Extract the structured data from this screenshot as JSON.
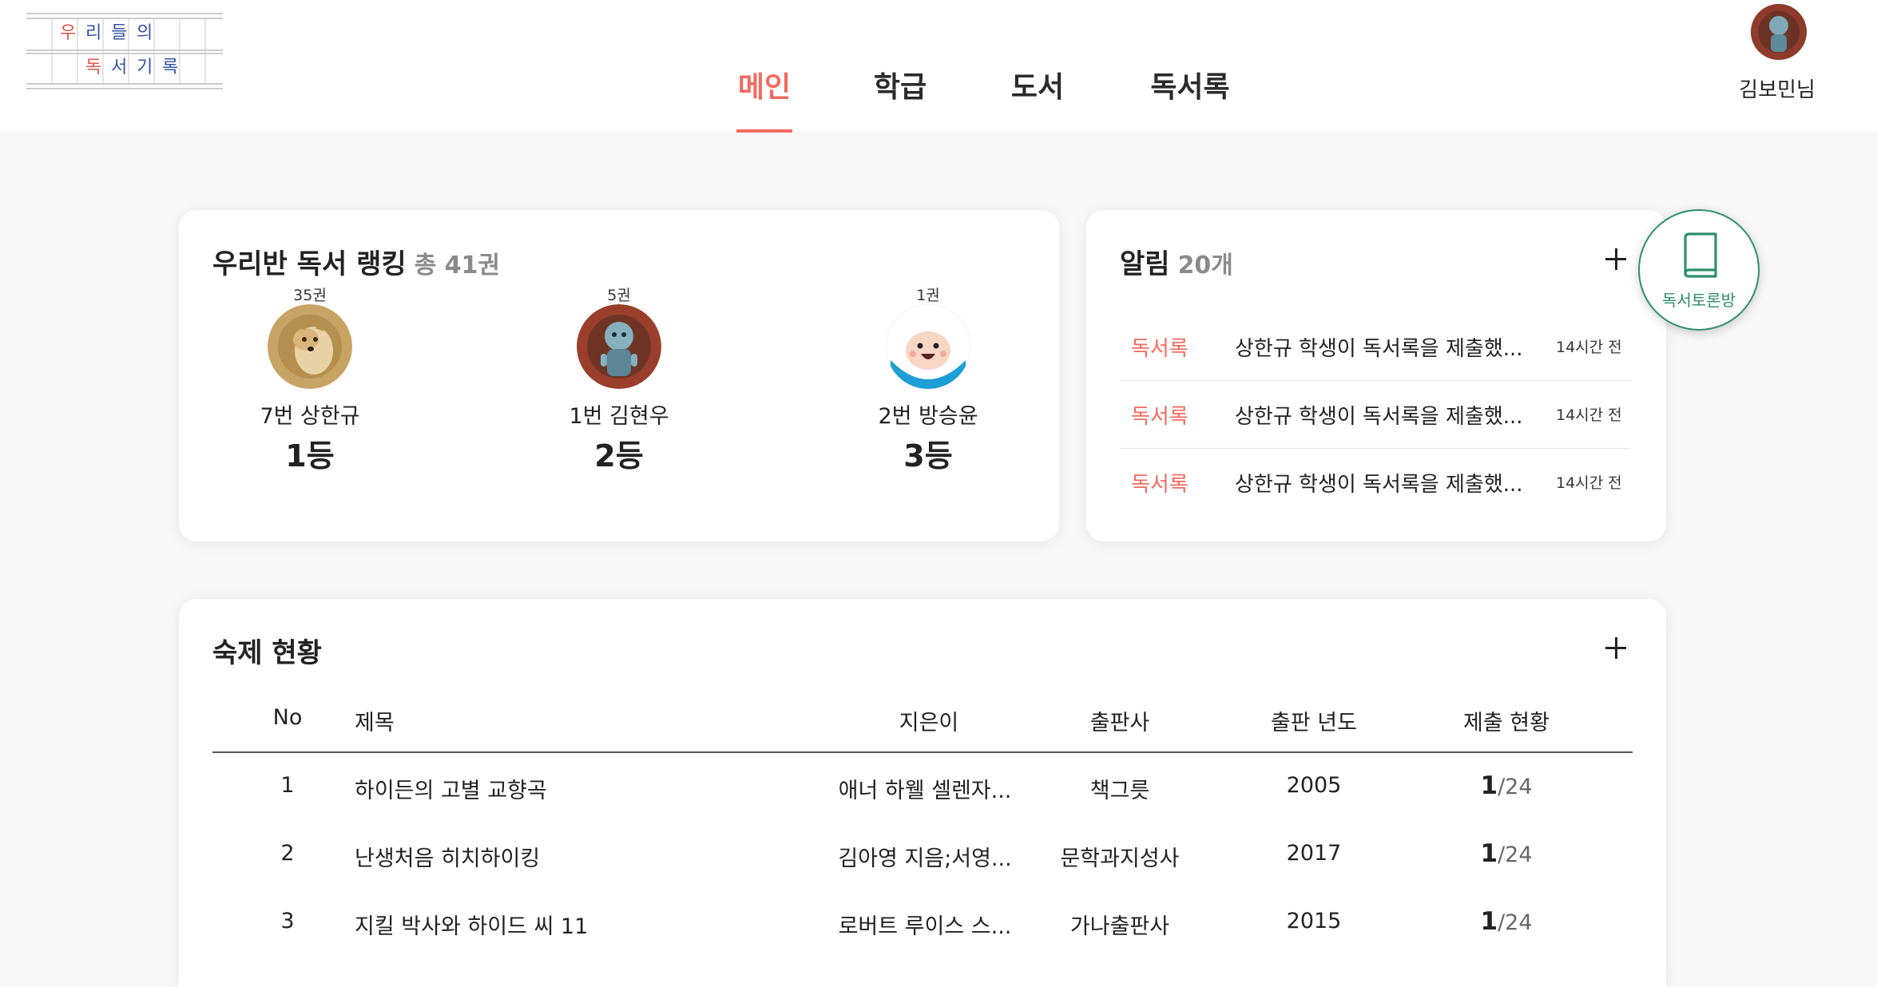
{
  "logo": {
    "row1": [
      "우",
      "리",
      "들",
      "의"
    ],
    "row2": [
      "독",
      "서",
      "기",
      "록"
    ]
  },
  "nav": {
    "tabs": [
      {
        "label": "메인",
        "active": true
      },
      {
        "label": "학급",
        "active": false
      },
      {
        "label": "도서",
        "active": false
      },
      {
        "label": "독서록",
        "active": false
      }
    ]
  },
  "user": {
    "name": "김보민님"
  },
  "ranking": {
    "title": "우리반 독서 랭킹",
    "total": "총 41권",
    "entries": [
      {
        "count": "35권",
        "name": "7번 상한규",
        "place": "1등",
        "avatar": "dog-avatar"
      },
      {
        "count": "5권",
        "name": "1번 김현우",
        "place": "2등",
        "avatar": "character-avatar"
      },
      {
        "count": "1권",
        "name": "2번 방승윤",
        "place": "3등",
        "avatar": "finn-avatar"
      }
    ]
  },
  "notifications": {
    "title": "알림",
    "count": "20개",
    "items": [
      {
        "category": "독서록",
        "message": "상한규 학생이 독서록을 제출했...",
        "time": "14시간 전"
      },
      {
        "category": "독서록",
        "message": "상한규 학생이 독서록을 제출했...",
        "time": "14시간 전"
      },
      {
        "category": "독서록",
        "message": "상한규 학생이 독서록을 제출했...",
        "time": "14시간 전"
      }
    ]
  },
  "discussion": {
    "label": "독서토론방",
    "icon": "book-icon"
  },
  "homework": {
    "title": "숙제 현황",
    "columns": [
      "No",
      "제목",
      "지은이",
      "출판사",
      "출판 년도",
      "제출 현황"
    ],
    "rows": [
      {
        "no": "1",
        "title": "하이든의 고별 교향곡",
        "author": "애너 하웰 셀렌자...",
        "publisher": "책그릇",
        "year": "2005",
        "submitted": "1",
        "total": "/24"
      },
      {
        "no": "2",
        "title": "난생처음 히치하이킹",
        "author": "김아영 지음;서영...",
        "publisher": "문학과지성사",
        "year": "2017",
        "submitted": "1",
        "total": "/24"
      },
      {
        "no": "3",
        "title": "지킬 박사와 하이드 씨 11",
        "author": "로버트 루이스 스...",
        "publisher": "가나출판사",
        "year": "2015",
        "submitted": "1",
        "total": "/24"
      }
    ]
  },
  "colors": {
    "accent": "#f26a5e",
    "discussion": "#2f8f6b",
    "background": "#f7f7f8"
  }
}
